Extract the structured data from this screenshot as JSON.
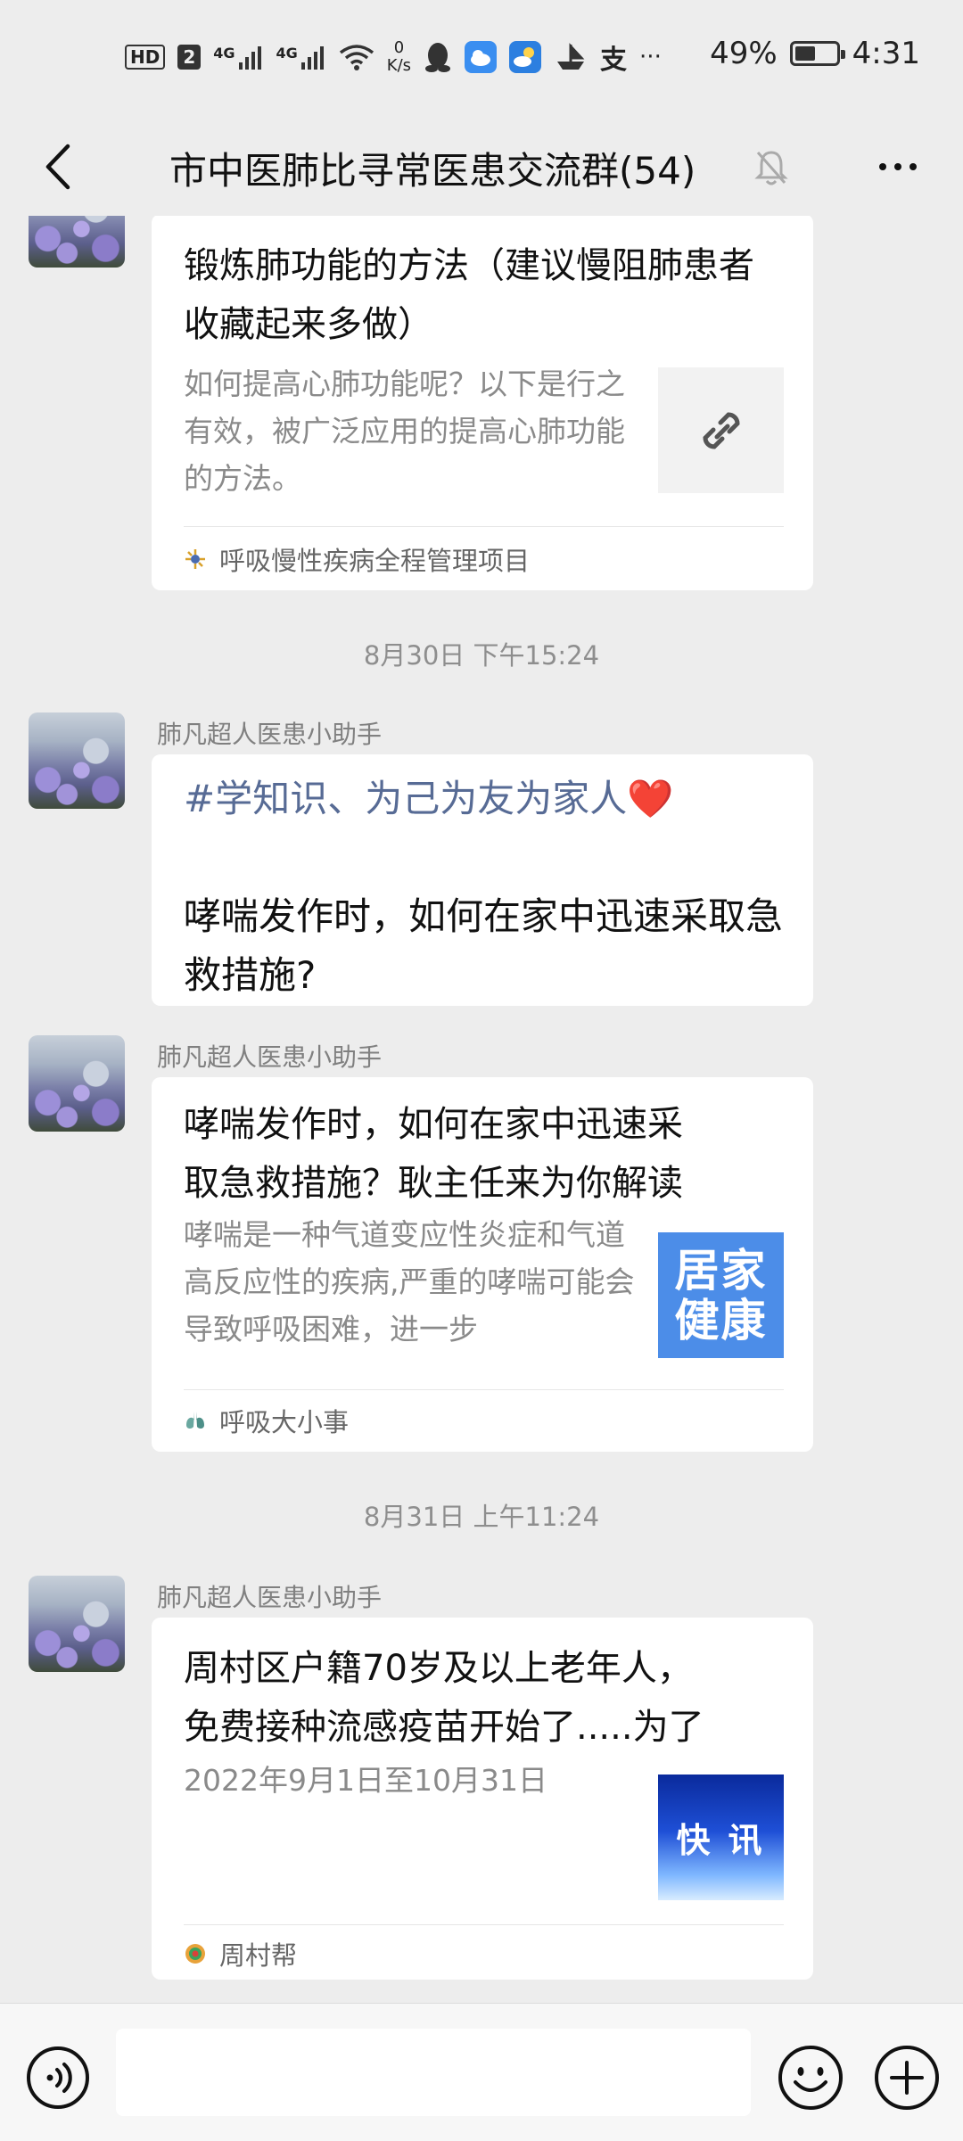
{
  "status_bar": {
    "hd_label": "HD",
    "sim_label": "2",
    "signal1_label": "4G",
    "signal2_label": "4G",
    "net_speed_value": "0",
    "net_speed_unit": "K/s",
    "extra_indicator": "···",
    "battery_percent": "49%",
    "battery_level": 0.49,
    "time": "4:31"
  },
  "header": {
    "title": "市中医肺比寻常医患交流群(54)"
  },
  "messages": {
    "m1": {
      "title": "锻炼肺功能的方法（建议慢阻肺患者收藏起来多做）",
      "desc": "如何提高心肺功能呢？以下是行之有效，被广泛应用的提高心肺功能的方法。",
      "source": "呼吸慢性疾病全程管理项目"
    },
    "ts1": "8月30日 下午15:24",
    "m2": {
      "sender": "肺凡超人医患小助手",
      "hashtag": "#学知识、为己为友为家人",
      "heart": "❤️",
      "text": "哮喘发作时，如何在家中迅速采取急救措施?"
    },
    "m3": {
      "sender": "肺凡超人医患小助手",
      "title_line1": "哮喘发作时，如何在家中迅速采",
      "title_line2": "取急救措施？耿主任来为你解读",
      "desc": "哮喘是一种气道变应性炎症和气道高反应性的疾病,严重的哮喘可能会导致呼吸困难，进一步",
      "thumb_line1": "居家",
      "thumb_line2": "健康",
      "source": "呼吸大小事"
    },
    "ts2": "8月31日 上午11:24",
    "m4": {
      "sender": "肺凡超人医患小助手",
      "title_line1": "周村区户籍70岁及以上老年人，",
      "title_line2": "免费接种流感疫苗开始了.....为了",
      "desc": "2022年9月1日至10月31日",
      "thumb_text": "快讯",
      "source": "周村帮"
    }
  },
  "colors": {
    "background": "#ededed",
    "hashtag": "#576b95",
    "thumb_blue": "#4c8de8"
  },
  "icons": [
    "back-arrow-icon",
    "mute-bell-icon",
    "more-dots-icon",
    "link-icon",
    "voice-icon",
    "emoji-icon",
    "plus-icon",
    "wifi-icon",
    "qq-icon",
    "cloud-icon",
    "weather-icon"
  ]
}
